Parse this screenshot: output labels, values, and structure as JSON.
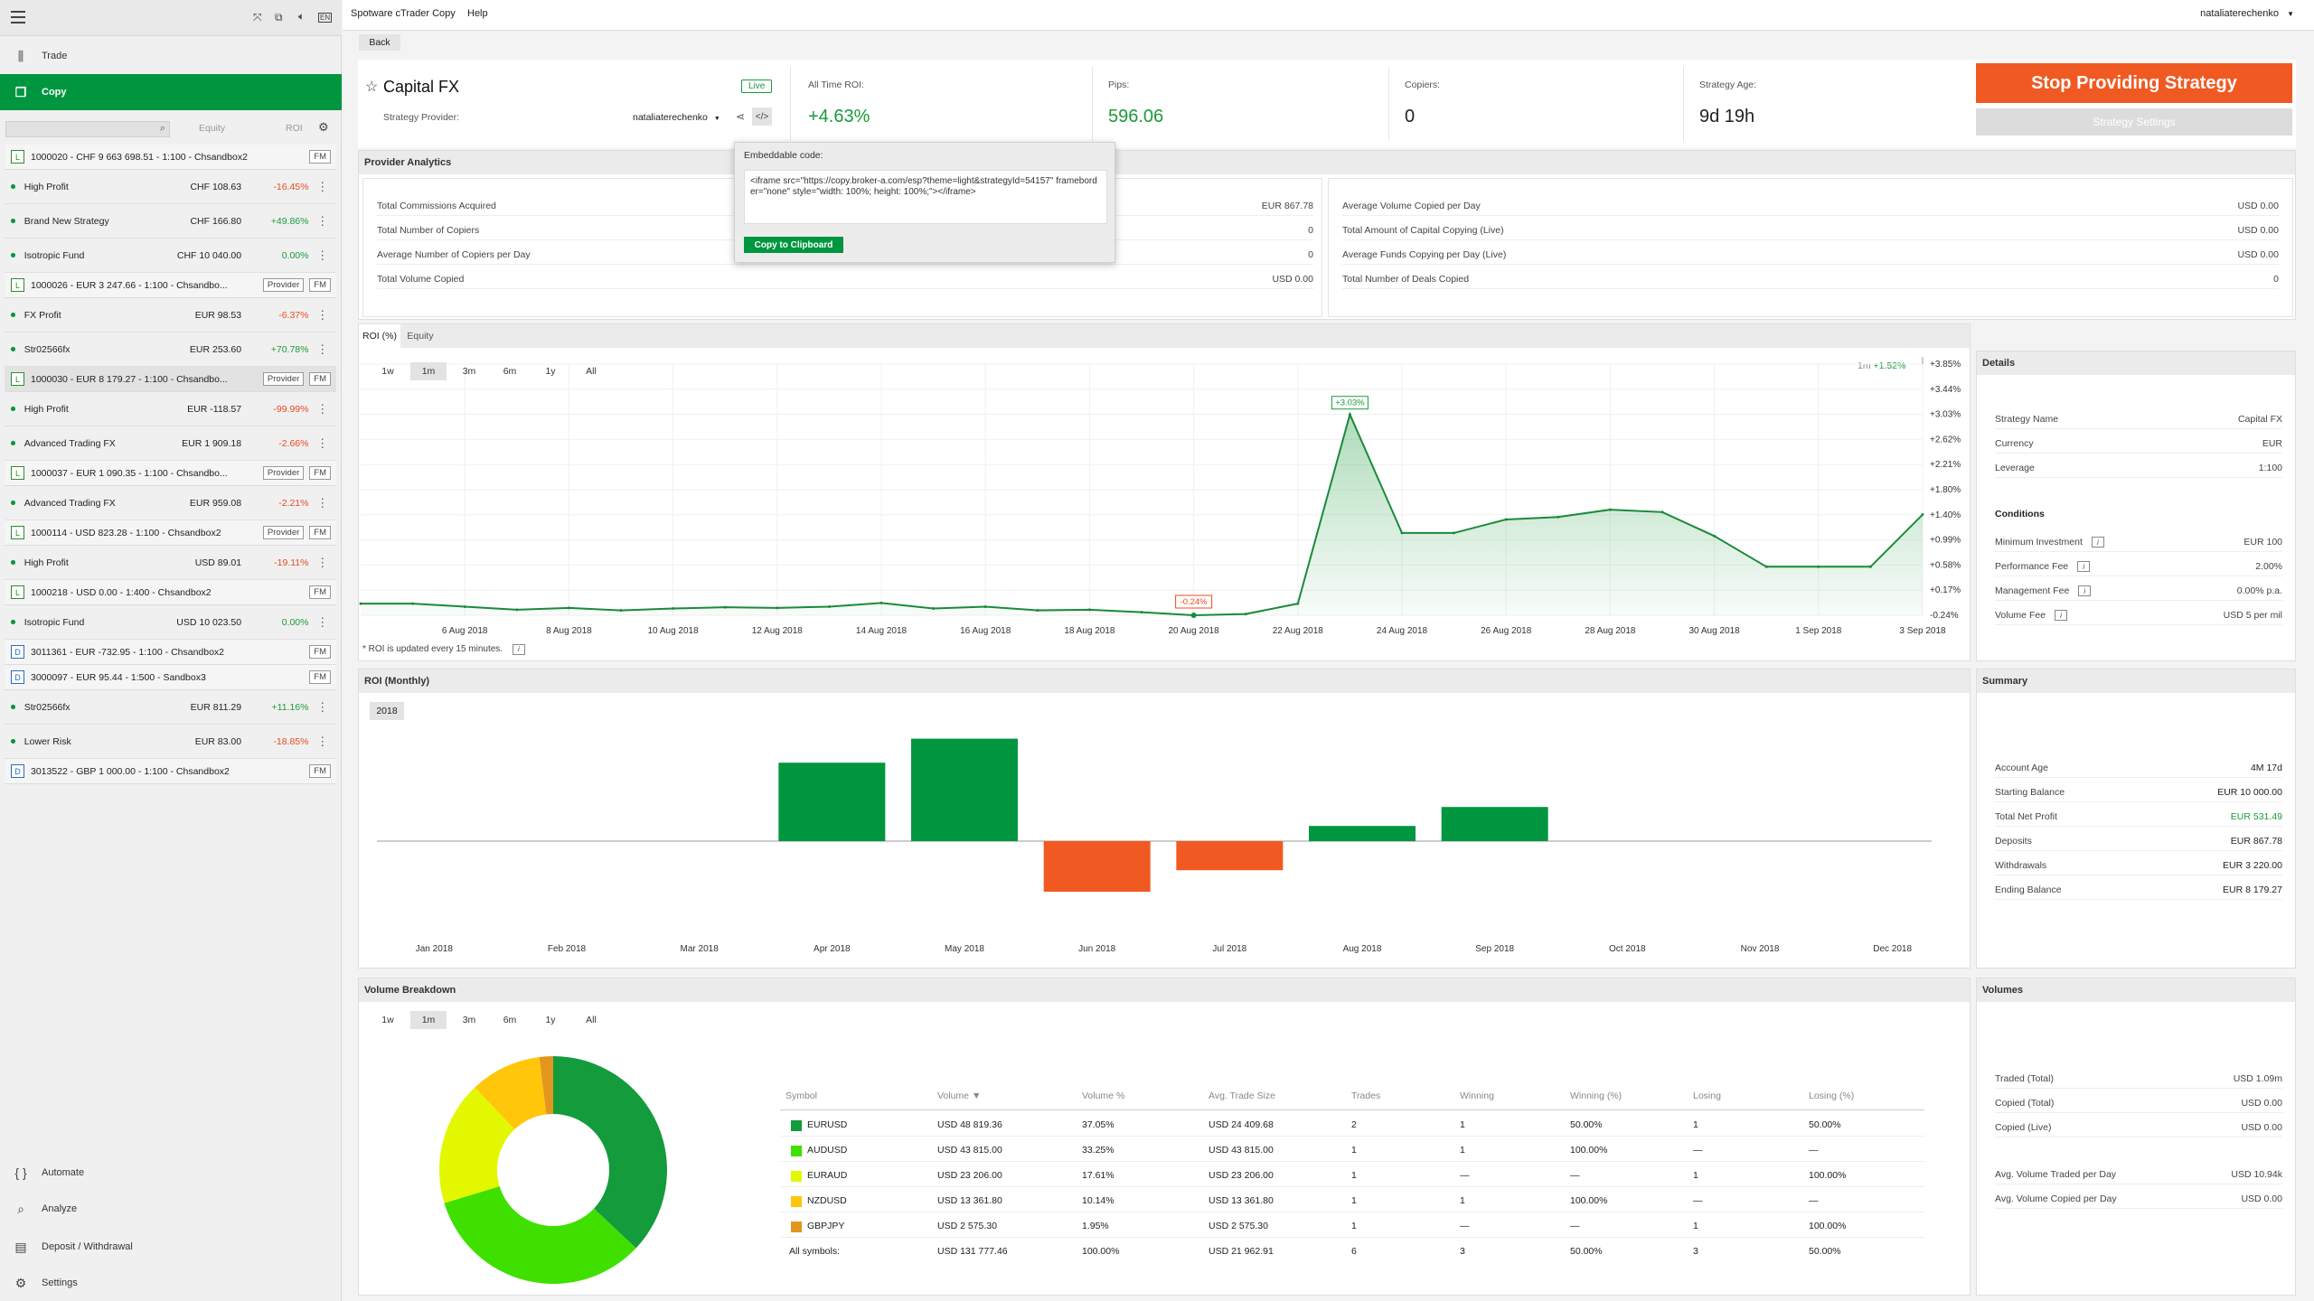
{
  "topbar": {
    "app_title": "Spotware cTrader Copy",
    "help": "Help",
    "user": "nataliaterechenko"
  },
  "sidebar": {
    "nav": {
      "trade": "Trade",
      "copy": "Copy",
      "automate": "Automate",
      "analyze": "Analyze",
      "deposit": "Deposit / Withdrawal",
      "settings": "Settings"
    },
    "columns": {
      "equity": "Equity",
      "roi": "ROI"
    },
    "rows": [
      {
        "kind": "account",
        "badge": "L",
        "title": "1000020 - CHF 9 663 698.51 - 1:100 - Chsandbox2",
        "tags": [
          "FM"
        ]
      },
      {
        "kind": "strategy",
        "name": "High Profit",
        "equity": "CHF 108.63",
        "roi": "-16.45%",
        "sign": "neg"
      },
      {
        "kind": "strategy",
        "name": "Brand New Strategy",
        "equity": "CHF 166.80",
        "roi": "+49.86%",
        "sign": "pos"
      },
      {
        "kind": "strategy",
        "name": "Isotropic Fund",
        "equity": "CHF 10 040.00",
        "roi": "0.00%",
        "sign": "pos"
      },
      {
        "kind": "account",
        "badge": "L",
        "title": "1000026 - EUR 3 247.66 - 1:100 - Chsandbo...",
        "tags": [
          "Provider",
          "FM"
        ]
      },
      {
        "kind": "strategy",
        "name": "FX Profit",
        "equity": "EUR 98.53",
        "roi": "-6.37%",
        "sign": "neg"
      },
      {
        "kind": "strategy",
        "name": "Str02566fx",
        "equity": "EUR 253.60",
        "roi": "+70.78%",
        "sign": "pos"
      },
      {
        "kind": "account",
        "badge": "L",
        "title": "1000030 - EUR 8 179.27 - 1:100 - Chsandbo...",
        "tags": [
          "Provider",
          "FM"
        ],
        "selected": true
      },
      {
        "kind": "strategy",
        "name": "High Profit",
        "equity": "EUR -118.57",
        "roi": "-99.99%",
        "sign": "neg"
      },
      {
        "kind": "strategy",
        "name": "Advanced Trading FX",
        "equity": "EUR 1 909.18",
        "roi": "-2.66%",
        "sign": "neg"
      },
      {
        "kind": "account",
        "badge": "L",
        "title": "1000037 - EUR 1 090.35 - 1:100 - Chsandbo...",
        "tags": [
          "Provider",
          "FM"
        ]
      },
      {
        "kind": "strategy",
        "name": "Advanced Trading FX",
        "equity": "EUR 959.08",
        "roi": "-2.21%",
        "sign": "neg"
      },
      {
        "kind": "account",
        "badge": "L",
        "title": "1000114 - USD 823.28 - 1:100 - Chsandbox2",
        "tags": [
          "Provider",
          "FM"
        ]
      },
      {
        "kind": "strategy",
        "name": "High Profit",
        "equity": "USD 89.01",
        "roi": "-19.11%",
        "sign": "neg"
      },
      {
        "kind": "account",
        "badge": "L",
        "title": "1000218 - USD 0.00 - 1:400 - Chsandbox2",
        "tags": [
          "FM"
        ]
      },
      {
        "kind": "strategy",
        "name": "Isotropic Fund",
        "equity": "USD 10 023.50",
        "roi": "0.00%",
        "sign": "pos"
      },
      {
        "kind": "account",
        "badge": "D",
        "title": "3011361 - EUR -732.95 - 1:100 - Chsandbox2",
        "tags": [
          "FM"
        ]
      },
      {
        "kind": "account",
        "badge": "D",
        "title": "3000097 - EUR 95.44 - 1:500 - Sandbox3",
        "tags": [
          "FM"
        ]
      },
      {
        "kind": "strategy",
        "name": "Str02566fx",
        "equity": "EUR 811.29",
        "roi": "+11.16%",
        "sign": "pos"
      },
      {
        "kind": "strategy",
        "name": "Lower Risk",
        "equity": "EUR 83.00",
        "roi": "-18.85%",
        "sign": "neg"
      },
      {
        "kind": "account",
        "badge": "D",
        "title": "3013522 - GBP 1 000.00 - 1:100 - Chsandbox2",
        "tags": [
          "FM"
        ]
      }
    ]
  },
  "header": {
    "back": "Back",
    "strategy_name": "Capital FX",
    "live_badge": "Live",
    "provider_label": "Strategy Provider:",
    "provider_name": "nataliaterechenko",
    "stats": [
      {
        "label": "All Time ROI:",
        "value": "+4.63%",
        "color": "#1a9a3a"
      },
      {
        "label": "Pips:",
        "value": "596.06",
        "color": "#1a9a3a"
      },
      {
        "label": "Copiers:",
        "value": "0",
        "color": "#222"
      },
      {
        "label": "Strategy Age:",
        "value": "9d 19h",
        "color": "#222"
      }
    ],
    "stop_button": "Stop Providing Strategy",
    "settings_button": "Strategy Settings"
  },
  "embed_popup": {
    "title": "Embeddable code:",
    "code": "<iframe src=\"https://copy.broker-a.com/esp?theme=light&strategyId=54157\" frameborder=\"none\" style=\"width: 100%; height: 100%;\"></iframe>",
    "copy_button": "Copy to Clipboard"
  },
  "provider_analytics": {
    "title": "Provider Analytics",
    "left": [
      {
        "label": "Total Commissions Acquired",
        "value": "EUR 867.78"
      },
      {
        "label": "Total Number of Copiers",
        "value": "0"
      },
      {
        "label": "Average Number of Copiers per Day",
        "value": "0"
      },
      {
        "label": "Total Volume Copied",
        "value": "USD 0.00"
      }
    ],
    "right": [
      {
        "label": "Average Volume Copied per Day",
        "value": "USD 0.00"
      },
      {
        "label": "Total Amount of Capital Copying (Live)",
        "value": "USD 0.00"
      },
      {
        "label": "Average Funds Copying per Day (Live)",
        "value": "USD 0.00"
      },
      {
        "label": "Total Number of Deals Copied",
        "value": "0"
      }
    ]
  },
  "roi_chart": {
    "tabs": [
      "ROI (%)",
      "Equity"
    ],
    "ranges": [
      "1w",
      "1m",
      "3m",
      "6m",
      "1y",
      "All"
    ],
    "active_range": "1m",
    "period_label": "1m",
    "period_value": "+1.52%",
    "note": "* ROI is updated every 15 minutes.",
    "y_ticks": [
      "+3.85%",
      "+3.44%",
      "+3.03%",
      "+2.62%",
      "+2.21%",
      "+1.80%",
      "+1.40%",
      "+0.99%",
      "+0.58%",
      "+0.17%",
      "-0.24%"
    ],
    "x_ticks": [
      "6 Aug 2018",
      "8 Aug 2018",
      "10 Aug 2018",
      "12 Aug 2018",
      "14 Aug 2018",
      "16 Aug 2018",
      "18 Aug 2018",
      "20 Aug 2018",
      "22 Aug 2018",
      "24 Aug 2018",
      "26 Aug 2018",
      "28 Aug 2018",
      "30 Aug 2018",
      "1 Sep 2018",
      "3 Sep 2018"
    ],
    "max_label": "+3.03%",
    "min_label": "-0.24%"
  },
  "chart_data": [
    {
      "type": "area",
      "title": "ROI (%)",
      "x": [
        "4 Aug 2018",
        "5 Aug 2018",
        "6 Aug 2018",
        "7 Aug 2018",
        "8 Aug 2018",
        "9 Aug 2018",
        "10 Aug 2018",
        "11 Aug 2018",
        "12 Aug 2018",
        "13 Aug 2018",
        "14 Aug 2018",
        "15 Aug 2018",
        "16 Aug 2018",
        "17 Aug 2018",
        "18 Aug 2018",
        "19 Aug 2018",
        "20 Aug 2018",
        "21 Aug 2018",
        "22 Aug 2018",
        "23 Aug 2018",
        "24 Aug 2018",
        "25 Aug 2018",
        "26 Aug 2018",
        "27 Aug 2018",
        "28 Aug 2018",
        "29 Aug 2018",
        "30 Aug 2018",
        "31 Aug 2018",
        "1 Sep 2018",
        "2 Sep 2018",
        "3 Sep 2018"
      ],
      "values": [
        -0.05,
        -0.05,
        -0.1,
        -0.15,
        -0.12,
        -0.16,
        -0.13,
        -0.11,
        -0.12,
        -0.1,
        -0.04,
        -0.13,
        -0.1,
        -0.16,
        -0.15,
        -0.19,
        -0.24,
        -0.22,
        -0.05,
        3.03,
        1.1,
        1.1,
        1.32,
        1.36,
        1.48,
        1.44,
        1.05,
        0.55,
        0.55,
        0.55,
        1.4
      ],
      "ylim": [
        -0.24,
        3.85
      ]
    },
    {
      "type": "bar",
      "title": "ROI (Monthly)",
      "categories": [
        "Jan 2018",
        "Feb 2018",
        "Mar 2018",
        "Apr 2018",
        "May 2018",
        "Jun 2018",
        "Jul 2018",
        "Aug 2018",
        "Sep 2018",
        "Oct 2018",
        "Nov 2018",
        "Dec 2018"
      ],
      "values": [
        0,
        0,
        0,
        3.1,
        4.05,
        -2.0,
        -1.15,
        0.6,
        1.35,
        0,
        0,
        0
      ],
      "ylim": [
        -4.5,
        4.5
      ]
    },
    {
      "type": "pie",
      "title": "Volume Breakdown",
      "categories": [
        "EURUSD",
        "AUDUSD",
        "EURAUD",
        "NZDUSD",
        "GBPJPY"
      ],
      "values": [
        37.05,
        33.25,
        17.61,
        10.14,
        1.95
      ],
      "colors": [
        "#139b3c",
        "#3fe000",
        "#e3f800",
        "#ffc60a",
        "#e3961e"
      ]
    }
  ],
  "roi_monthly": {
    "title": "ROI (Monthly)",
    "year": "2018"
  },
  "details": {
    "title": "Details",
    "rows": [
      {
        "label": "Strategy Name",
        "value": "Capital FX"
      },
      {
        "label": "Currency",
        "value": "EUR"
      },
      {
        "label": "Leverage",
        "value": "1:100"
      }
    ],
    "conditions_title": "Conditions",
    "conditions": [
      {
        "label": "Minimum Investment",
        "value": "EUR 100"
      },
      {
        "label": "Performance Fee",
        "value": "2.00%"
      },
      {
        "label": "Management Fee",
        "value": "0.00% p.a."
      },
      {
        "label": "Volume Fee",
        "value": "USD 5 per mil"
      }
    ]
  },
  "summary": {
    "title": "Summary",
    "rows": [
      {
        "label": "Account Age",
        "value": "4M 17d",
        "color": "#222"
      },
      {
        "label": "Starting Balance",
        "value": "EUR 10 000.00",
        "color": "#222"
      },
      {
        "label": "Total Net Profit",
        "value": "EUR 531.49",
        "color": "#1a9a3a"
      },
      {
        "label": "Deposits",
        "value": "EUR 867.78",
        "color": "#222"
      },
      {
        "label": "Withdrawals",
        "value": "EUR 3 220.00",
        "color": "#222"
      },
      {
        "label": "Ending Balance",
        "value": "EUR 8 179.27",
        "color": "#222"
      }
    ]
  },
  "volume_breakdown": {
    "title": "Volume Breakdown",
    "ranges": [
      "1w",
      "1m",
      "3m",
      "6m",
      "1y",
      "All"
    ],
    "active_range": "1m",
    "headers": [
      "Symbol",
      "Volume ▼",
      "Volume %",
      "Avg. Trade Size",
      "Trades",
      "Winning",
      "Winning (%)",
      "Losing",
      "Losing (%)"
    ],
    "rows": [
      {
        "color": "#139b3c",
        "cells": [
          "EURUSD",
          "USD 48 819.36",
          "37.05%",
          "USD 24 409.68",
          "2",
          "1",
          "50.00%",
          "1",
          "50.00%"
        ]
      },
      {
        "color": "#3fe000",
        "cells": [
          "AUDUSD",
          "USD 43 815.00",
          "33.25%",
          "USD 43 815.00",
          "1",
          "1",
          "100.00%",
          "—",
          "—"
        ]
      },
      {
        "color": "#e3f800",
        "cells": [
          "EURAUD",
          "USD 23 206.00",
          "17.61%",
          "USD 23 206.00",
          "1",
          "—",
          "—",
          "1",
          "100.00%"
        ]
      },
      {
        "color": "#ffc60a",
        "cells": [
          "NZDUSD",
          "USD 13 361.80",
          "10.14%",
          "USD 13 361.80",
          "1",
          "1",
          "100.00%",
          "—",
          "—"
        ]
      },
      {
        "color": "#e3961e",
        "cells": [
          "GBPJPY",
          "USD 2 575.30",
          "1.95%",
          "USD 2 575.30",
          "1",
          "—",
          "—",
          "1",
          "100.00%"
        ]
      }
    ],
    "total": [
      "All symbols:",
      "USD 131 777.46",
      "100.00%",
      "USD 21 962.91",
      "6",
      "3",
      "50.00%",
      "3",
      "50.00%"
    ]
  },
  "volumes": {
    "title": "Volumes",
    "rows": [
      {
        "label": "Traded (Total)",
        "value": "USD 1.09m"
      },
      {
        "label": "Copied (Total)",
        "value": "USD 0.00"
      },
      {
        "label": "Copied (Live)",
        "value": "USD 0.00"
      }
    ],
    "rows2": [
      {
        "label": "Avg. Volume Traded per Day",
        "value": "USD 10.94k"
      },
      {
        "label": "Avg. Volume Copied per Day",
        "value": "USD 0.00"
      }
    ]
  },
  "colors": {
    "brand_green": "#00963f",
    "profit": "#1a9a3a",
    "loss": "#e84c1f",
    "stop_button": "#f05a22"
  }
}
